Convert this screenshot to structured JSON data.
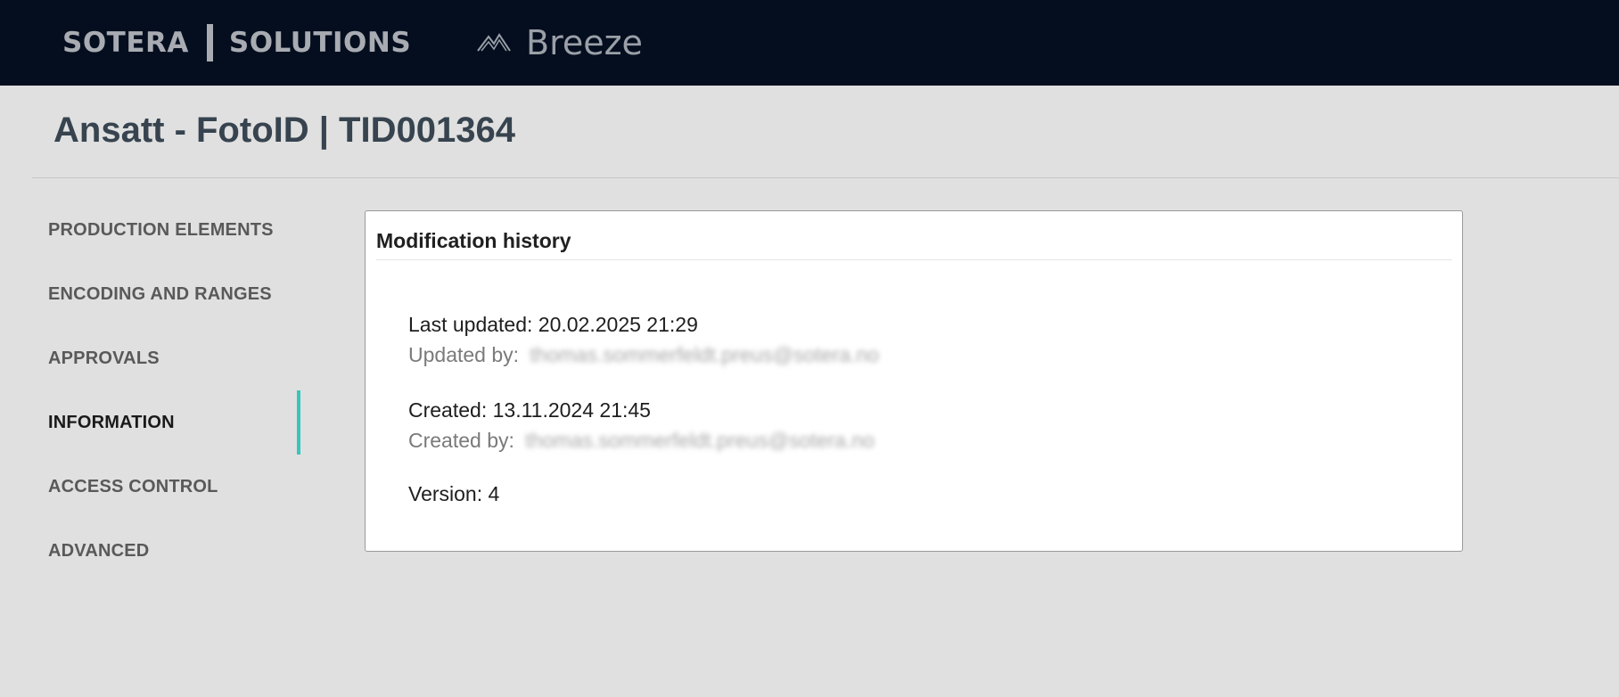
{
  "header": {
    "brand_left": "SOTERA",
    "brand_right": "SOLUTIONS",
    "app_icon": "breeze-mountain-icon",
    "app_name": "Breeze",
    "background": "#040e1f"
  },
  "page": {
    "title": "Ansatt - FotoID | TID001364"
  },
  "sidebar": {
    "accent_color": "#34c7bd",
    "items": [
      {
        "label": "PRODUCTION ELEMENTS",
        "active": false
      },
      {
        "label": "ENCODING AND RANGES",
        "active": false
      },
      {
        "label": "APPROVALS",
        "active": false
      },
      {
        "label": "INFORMATION",
        "active": true
      },
      {
        "label": "ACCESS CONTROL",
        "active": false
      },
      {
        "label": "ADVANCED",
        "active": false
      }
    ]
  },
  "modification_history": {
    "title": "Modification history",
    "last_updated_label": "Last updated:",
    "last_updated_value": "20.02.2025 21:29",
    "updated_by_label": "Updated by:",
    "updated_by_value": "thomas.sommerfeldt.preus@sotera.no",
    "created_label": "Created:",
    "created_value": "13.11.2024 21:45",
    "created_by_label": "Created by:",
    "created_by_value": "thomas.sommerfeldt.preus@sotera.no",
    "version_label": "Version:",
    "version_value": "4"
  }
}
